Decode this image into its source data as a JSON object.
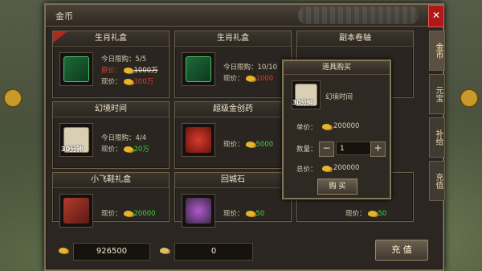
{
  "panel": {
    "title": "金币",
    "close": "✕"
  },
  "side_tabs": [
    "金币",
    "元宝",
    "补给",
    "充值"
  ],
  "cards": [
    {
      "name": "生肖礼盒",
      "limit_label": "今日限购：",
      "limit": "5/5",
      "orig_label": "原价：",
      "orig_price": "1000万",
      "price_label": "现价：",
      "price": "300万",
      "icon": "green-chest-icon"
    },
    {
      "name": "生肖礼盒",
      "limit_label": "今日限购：",
      "limit": "10/10",
      "price_label": "现价：",
      "price": "1000",
      "icon": "green-chest-icon"
    },
    {
      "name": "副本卷轴",
      "icon": "scroll-icon"
    },
    {
      "name": "幻境时间",
      "limit_label": "今日限购：",
      "limit": "4/4",
      "price_label": "现价：",
      "price": "20万",
      "icon": "time-scroll-icon",
      "icon_text": "30分钟"
    },
    {
      "name": "超级金创药",
      "price_label": "现价：",
      "price": "5000",
      "icon": "potion-icon"
    },
    {
      "name": "小飞鞋礼盒",
      "price_label": "现价：",
      "price": "20000",
      "icon": "boot-icon"
    },
    {
      "name": "回城石",
      "price_label": "现价：",
      "price": "50",
      "icon": "stone-icon"
    },
    {
      "price_label": "现价：",
      "price": "50"
    }
  ],
  "dialog": {
    "title": "道具购买",
    "item_name": "幻境时间",
    "icon_text": "30分钟",
    "unit_label": "单价：",
    "unit_price": "200000",
    "qty_label": "数量：",
    "qty": "1",
    "minus": "−",
    "plus": "+",
    "total_label": "总价：",
    "total": "200000",
    "buy": "购 买"
  },
  "bottom": {
    "gold": "926500",
    "ingot": "0",
    "recharge": "充 值"
  },
  "colors": {
    "accent_green": "#3fd13f",
    "price_red": "#e23a2a",
    "gold": "#e5b52b"
  }
}
